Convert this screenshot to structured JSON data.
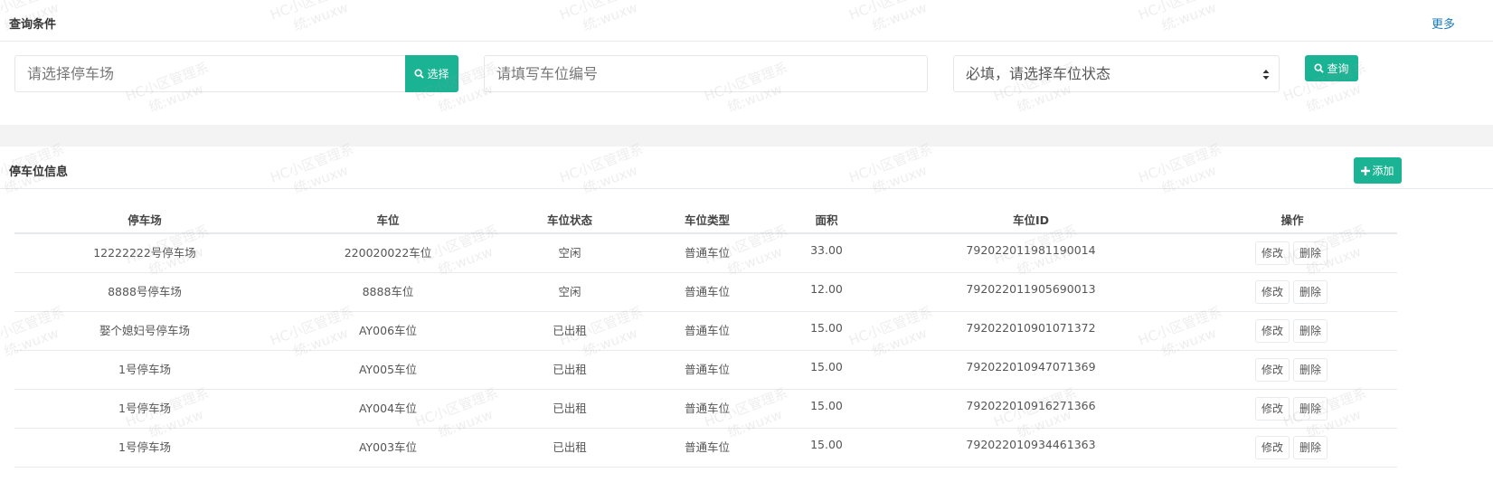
{
  "query_panel": {
    "title": "查询条件",
    "more_label": "更多",
    "parking_lot_placeholder": "请选择停车场",
    "select_label": "选择",
    "space_number_placeholder": "请填写车位编号",
    "status_select_value": "必填，请选择车位状态",
    "query_label": "查询"
  },
  "info_panel": {
    "title": "停车位信息",
    "add_label": "添加"
  },
  "table": {
    "headers": [
      "停车场",
      "车位",
      "车位状态",
      "车位类型",
      "面积",
      "车位ID",
      "操作"
    ],
    "edit_label": "修改",
    "delete_label": "删除",
    "rows": [
      [
        "12222222号停车场",
        "220020022车位",
        "空闲",
        "普通车位",
        "33.00",
        "792022011981190014"
      ],
      [
        "8888号停车场",
        "8888车位",
        "空闲",
        "普通车位",
        "12.00",
        "792022011905690013"
      ],
      [
        "娶个媳妇号停车场",
        "AY006车位",
        "已出租",
        "普通车位",
        "15.00",
        "792022010901071372"
      ],
      [
        "1号停车场",
        "AY005车位",
        "已出租",
        "普通车位",
        "15.00",
        "792022010947071369"
      ],
      [
        "1号停车场",
        "AY004车位",
        "已出租",
        "普通车位",
        "15.00",
        "792022010916271366"
      ],
      [
        "1号停车场",
        "AY003车位",
        "已出租",
        "普通车位",
        "15.00",
        "792022010934461363"
      ]
    ]
  },
  "watermark": {
    "line1": "HC小区管理系",
    "line2": "统:wuxw"
  },
  "icons": {
    "select": "search-icon",
    "query": "search-icon",
    "add": "plus-icon",
    "status_select": "updown-arrows-icon"
  },
  "colors": {
    "primary_button": "#1ab394",
    "link": "#1a7bb9"
  }
}
